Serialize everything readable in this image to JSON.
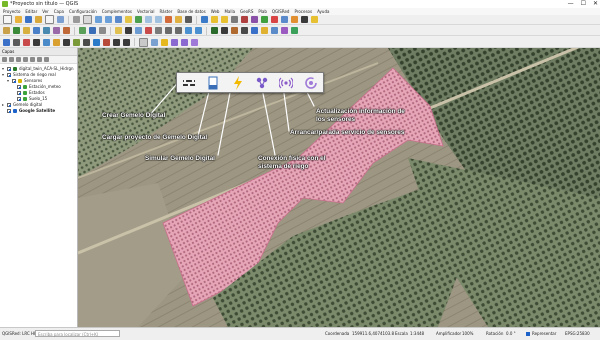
{
  "window": {
    "title": "*Proyecto sin título — QGIS",
    "controls": [
      "—",
      "☐",
      "✕"
    ]
  },
  "menu": [
    "Proyecto",
    "Editar",
    "Ver",
    "Capa",
    "Configuración",
    "Complementos",
    "Vectorial",
    "Ráster",
    "Base de datos",
    "Web",
    "Malla",
    "GeoRS",
    "Plab",
    "QGISRed",
    "Procesos",
    "Ayuda"
  ],
  "layers_panel": {
    "title": "Capas",
    "layers": [
      {
        "label": "digital_twin_ACA-SL_Hidrgn",
        "depth": 0,
        "checked": true,
        "swatch": "#2a7a2a",
        "expand": "▾"
      },
      {
        "label": "Sistema de riego real",
        "depth": 0,
        "checked": true,
        "swatch": "",
        "expand": "▾"
      },
      {
        "label": "Sensores",
        "depth": 1,
        "checked": true,
        "swatch": "#d9b400",
        "expand": "▾"
      },
      {
        "label": "Estación_meteo",
        "depth": 2,
        "checked": true,
        "swatch": "#3aa33a",
        "expand": ""
      },
      {
        "label": "Estados",
        "depth": 2,
        "checked": true,
        "swatch": "#3aa33a",
        "expand": ""
      },
      {
        "label": "Suelo_15",
        "depth": 2,
        "checked": true,
        "swatch": "#3aa33a",
        "expand": ""
      },
      {
        "label": "Gemelo digital",
        "depth": 0,
        "checked": true,
        "swatch": "",
        "expand": "▸"
      },
      {
        "label": "Google Satellite",
        "depth": 0,
        "checked": true,
        "swatch": "#1d62c9",
        "expand": ""
      }
    ]
  },
  "floating_toolbar": {
    "icons": [
      "network-icon",
      "document-icon",
      "lightning-icon",
      "nodes-icon",
      "wireless-icon",
      "refresh-icon"
    ]
  },
  "annotations": {
    "crear": "Crear Gemelo Digital",
    "cargar": "Cargar proyecto de Gemelo Digital",
    "simular": "Simular Gemelo Digital",
    "conexion_1": "Conexión física con el",
    "conexion_2": "sistema de riego",
    "actualizacion_1": "Actualización información de",
    "actualizacion_2": "los sensores",
    "arrancar": "Arrancar/parada servicio de sensores"
  },
  "statusbar": {
    "locator": "QGISRed: LRC HHB",
    "search_placeholder": "Escriba para localizar (Ctrl+K)",
    "coordinate_label": "Coordenada",
    "coordinate": "159911.6,4074103.8",
    "scale_label": "Escala",
    "scale": "1:3448",
    "magnifier_label": "Amplificador",
    "magnifier": "100%",
    "rotation_label": "Rotación",
    "rotation": "0.0 °",
    "render_label": "Representar",
    "crs": "EPSG:25830"
  },
  "colors": {
    "accent": "#1d62c9",
    "annotation_text": "#ffffff",
    "selected_area": "#e8a2b6"
  }
}
